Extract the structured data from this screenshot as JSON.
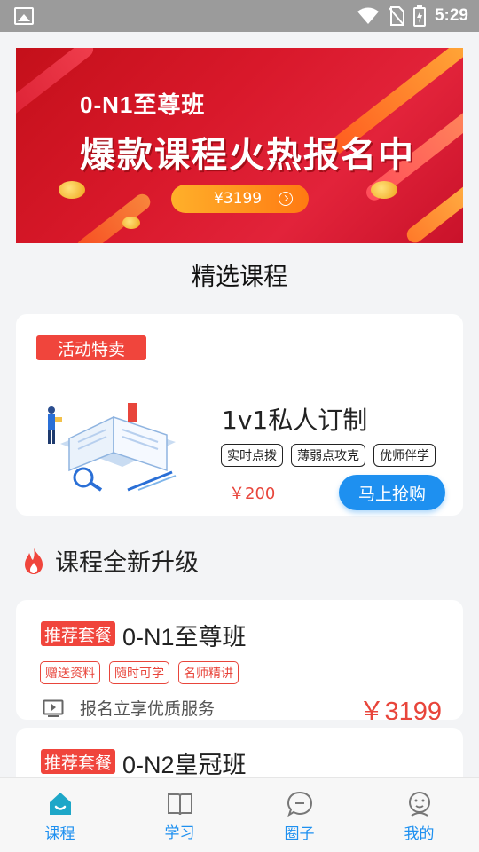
{
  "status_bar": {
    "time": "5:29"
  },
  "banner": {
    "subtitle": "0-N1至尊班",
    "title": "爆款课程火热报名中",
    "price": "¥3199"
  },
  "section_title": "精选课程",
  "featured": {
    "tag": "活动特卖",
    "title": "1v1私人订制",
    "chips": [
      "实时点拨",
      "薄弱点攻克",
      "优师伴学"
    ],
    "price": "￥200",
    "buy_label": "马上抢购"
  },
  "upgrade_title": "课程全新升级",
  "courses": [
    {
      "tag": "推荐套餐",
      "name": "0-N1至尊班",
      "chips": [
        "赠送资料",
        "随时可学",
        "名师精讲"
      ],
      "service": "报名立享优质服务",
      "price": "￥3199"
    },
    {
      "tag": "推荐套餐",
      "name": "0-N2皇冠班"
    }
  ],
  "tabbar": {
    "items": [
      {
        "label": "课程",
        "icon": "course-home-icon",
        "active": true
      },
      {
        "label": "学习",
        "icon": "book-icon",
        "active": false
      },
      {
        "label": "圈子",
        "icon": "chat-bubble-icon",
        "active": false
      },
      {
        "label": "我的",
        "icon": "profile-icon",
        "active": false
      }
    ]
  },
  "colors": {
    "accent": "#1e90f0",
    "red": "#e8453b",
    "tag_red": "#f0453c"
  }
}
